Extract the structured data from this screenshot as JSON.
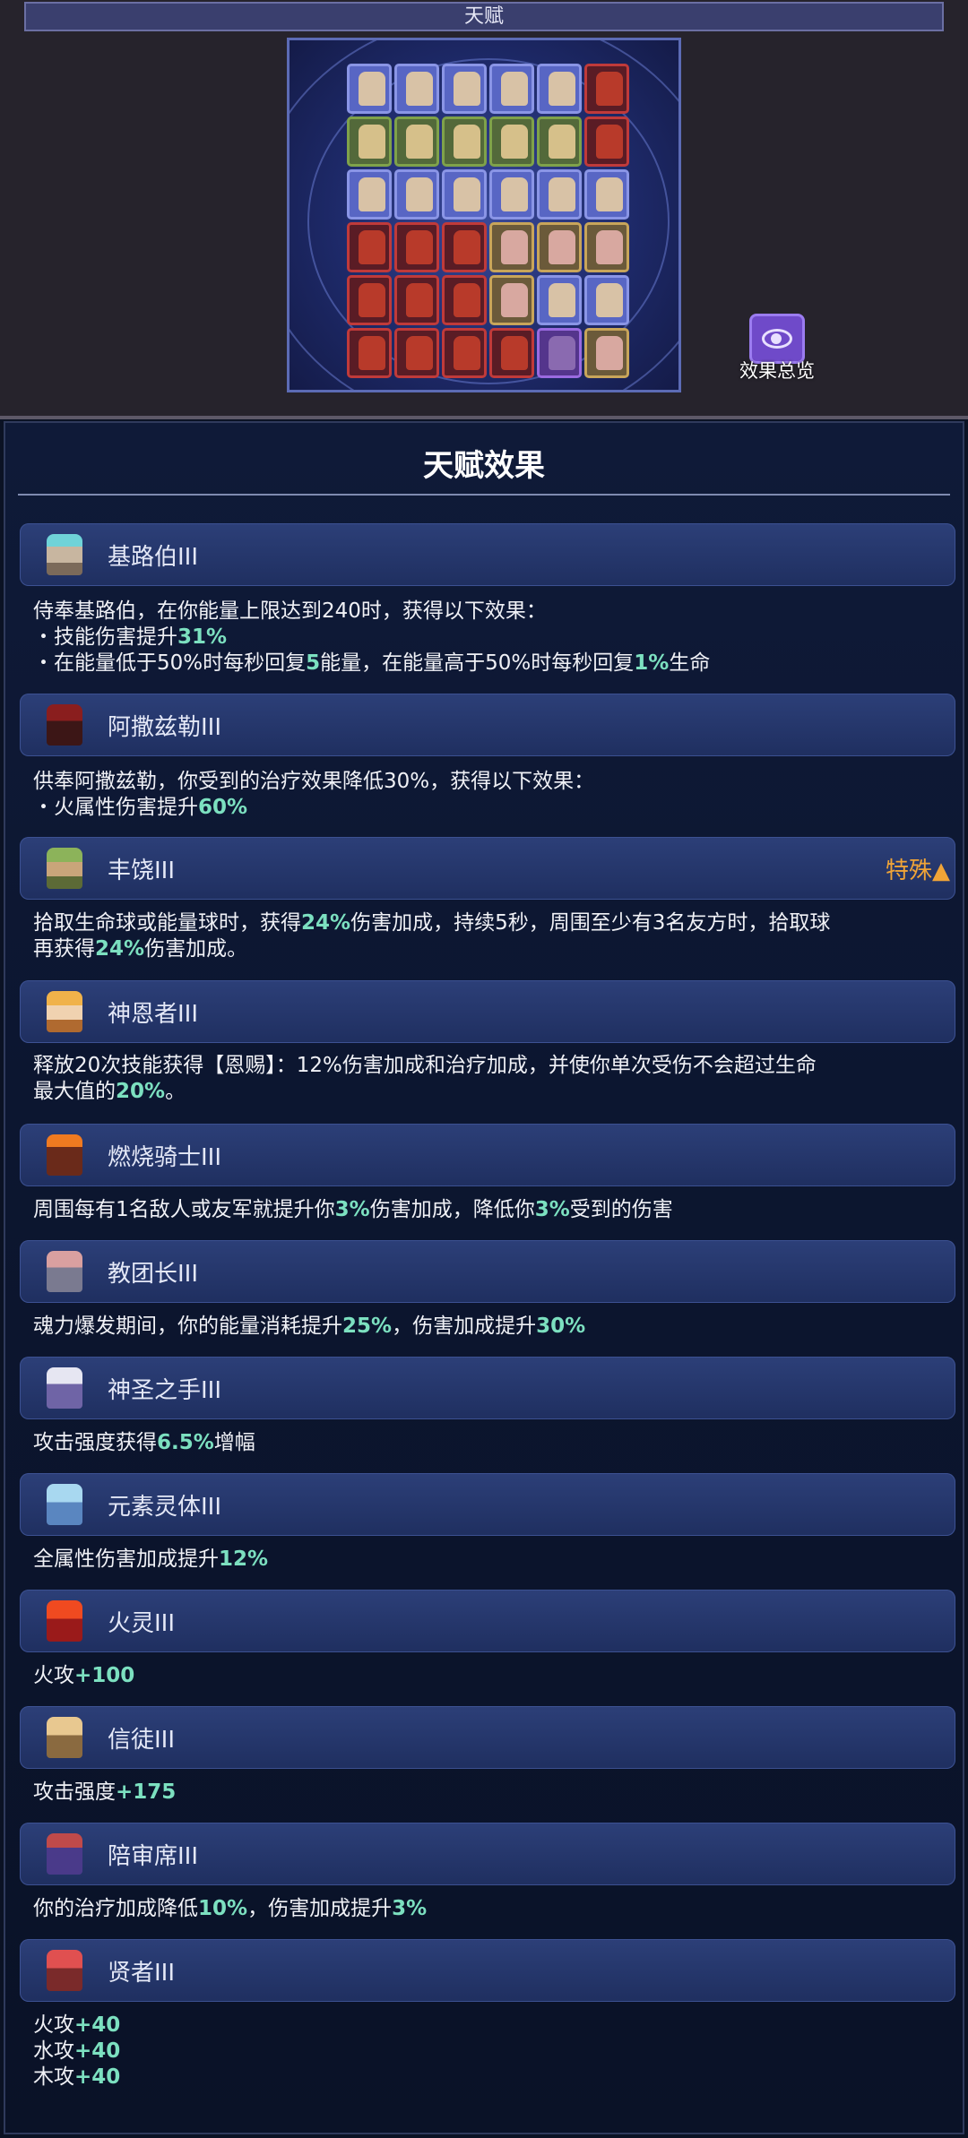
{
  "top": {
    "title": "天赋",
    "overview_label": "效果总览"
  },
  "board": {
    "rows": [
      [
        "blue",
        "blue",
        "blue",
        "blue",
        "blue",
        "red"
      ],
      [
        "green",
        "green",
        "green",
        "green",
        "green",
        "red"
      ],
      [
        "blue",
        "blue",
        "blue",
        "blue",
        "blue",
        "blue"
      ],
      [
        "red",
        "red",
        "red",
        "gold",
        "gold",
        "gold"
      ],
      [
        "red",
        "red",
        "red",
        "gold",
        "blue",
        "blue"
      ],
      [
        "red",
        "red",
        "red",
        "red",
        "purple",
        "gold"
      ]
    ]
  },
  "panel": {
    "title": "天赋效果",
    "entries": [
      {
        "icon": "kilobo-icon",
        "name": "基路伯III",
        "desc": "侍奉基路伯，在你能量上限达到240时，获得以下效果：\n・技能伤害提升31%\n・在能量低于50%时每秒回复5能量，在能量高于50%时每秒回复1%生命"
      },
      {
        "icon": "asazer-icon",
        "name": "阿撒兹勒III",
        "desc": "供奉阿撒兹勒，你受到的治疗效果降低30%，获得以下效果：\n・火属性伤害提升60%"
      },
      {
        "icon": "harvest-icon",
        "name": "丰饶III",
        "tag": "特殊▲",
        "desc": "拾取生命球或能量球时，获得24%伤害加成，持续5秒，周围至少有3名友方时，拾取球\n再获得24%伤害加成。"
      },
      {
        "icon": "blessed-icon",
        "name": "神恩者III",
        "desc": "释放20次技能获得【恩赐】：12%伤害加成和治疗加成，并使你单次受伤不会超过生命\n最大值的20%。"
      },
      {
        "icon": "burning-knight-icon",
        "name": "燃烧骑士III",
        "desc": "周围每有1名敌人或友军就提升你3%伤害加成，降低你3%受到的伤害"
      },
      {
        "icon": "cult-leader-icon",
        "name": "教团长III",
        "desc": "魂力爆发期间，你的能量消耗提升25%，伤害加成提升30%"
      },
      {
        "icon": "holy-hand-icon",
        "name": "神圣之手III",
        "desc": "攻击强度获得6.5%增幅"
      },
      {
        "icon": "elemental-icon",
        "name": "元素灵体III",
        "desc": "全属性伤害加成提升12%"
      },
      {
        "icon": "fire-spirit-icon",
        "name": "火灵III",
        "desc": "火攻+100"
      },
      {
        "icon": "believer-icon",
        "name": "信徒III",
        "desc": "攻击强度+175"
      },
      {
        "icon": "juror-icon",
        "name": "陪审席III",
        "desc": "你的治疗加成降低10%，伤害加成提升3%"
      },
      {
        "icon": "sage-icon",
        "name": "贤者III",
        "desc": "火攻+40\n水攻+40\n木攻+40"
      }
    ]
  },
  "colors": {
    "highlight": "#7ce0c0",
    "special_tag": "#f0a437",
    "header_bar": "#2c3f78"
  }
}
